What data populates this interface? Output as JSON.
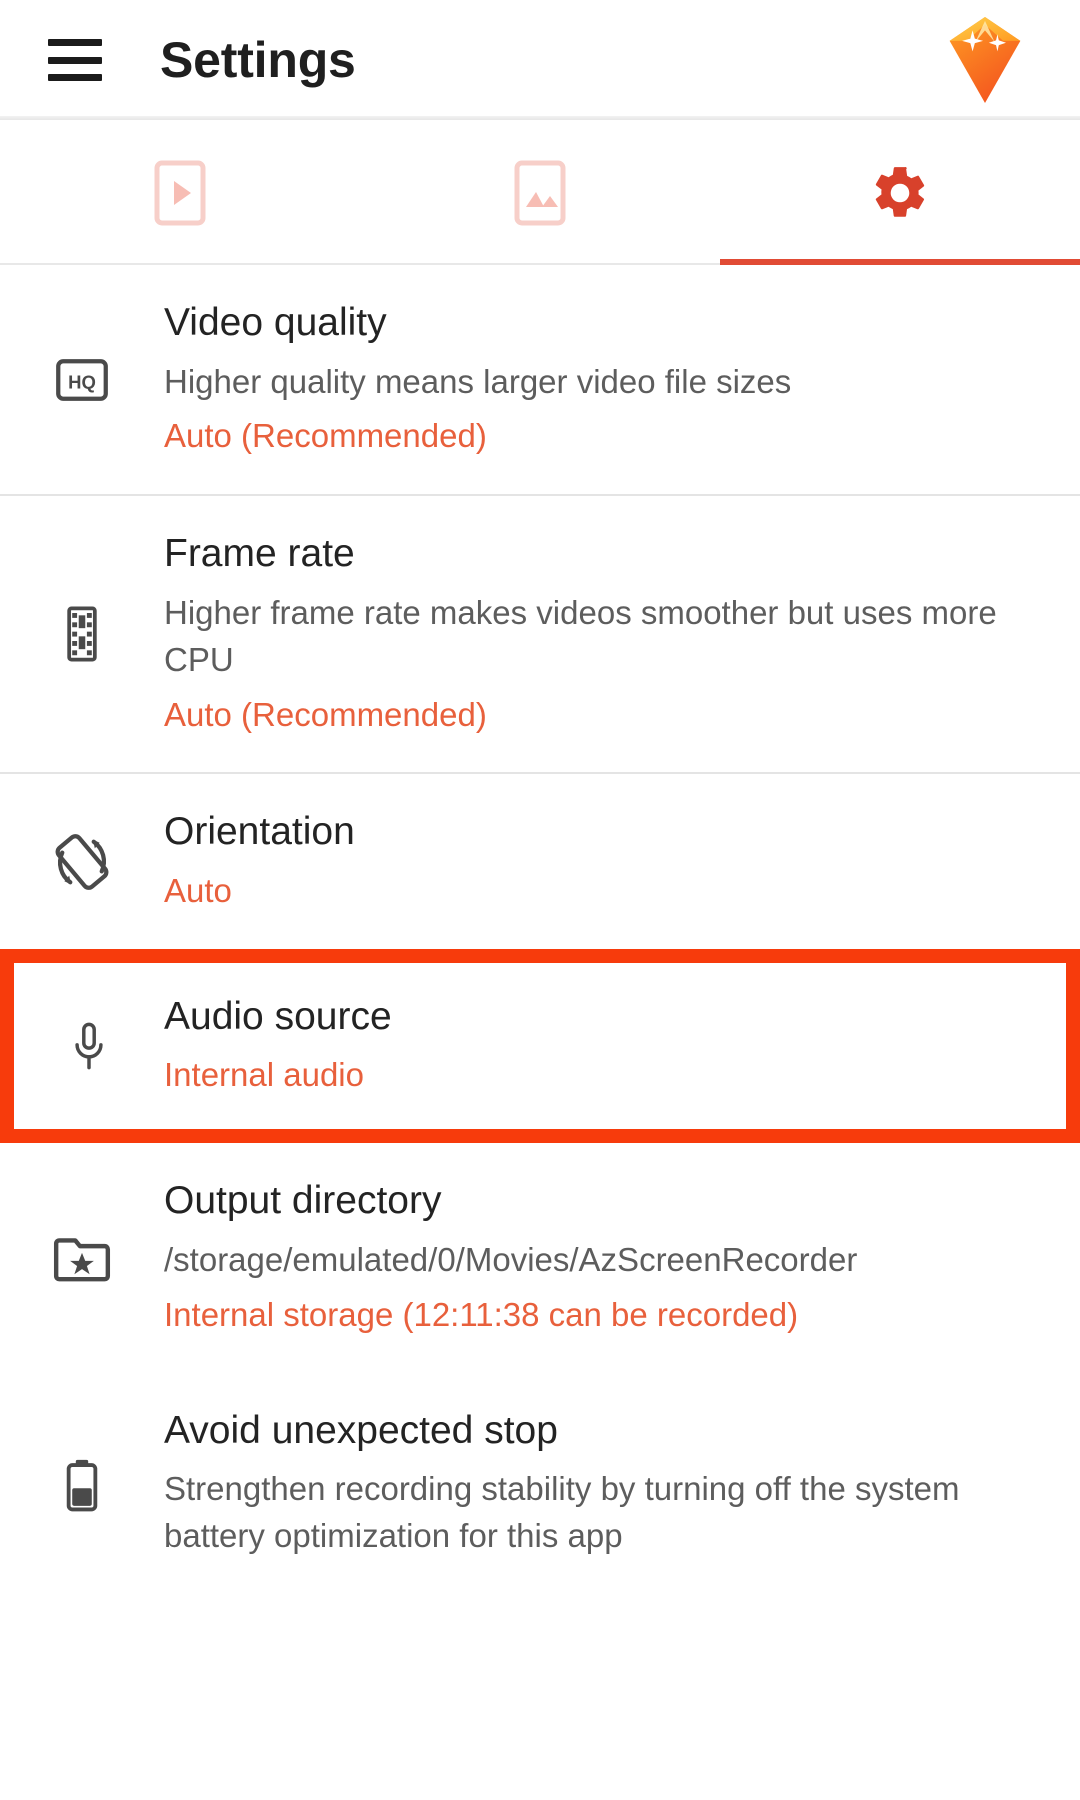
{
  "app": {
    "title": "Settings",
    "menu_icon": "hamburger-menu-icon",
    "logo_icon": "gem-diamond-logo"
  },
  "theme": {
    "accent": "#e8603c",
    "tab_active": "#d8412b",
    "tab_inactive": "#f7cfc9",
    "highlight_box": "#f73b0c",
    "title_text": "#232323",
    "desc_text": "#5d5d5d"
  },
  "tabs": [
    {
      "name": "tab-video",
      "icon": "video-player-icon",
      "active": false
    },
    {
      "name": "tab-images",
      "icon": "image-gallery-icon",
      "active": false
    },
    {
      "name": "tab-settings",
      "icon": "gear-icon",
      "active": true
    }
  ],
  "settings": [
    {
      "key": "video-quality",
      "icon": "hq-badge-icon",
      "title": "Video quality",
      "desc": "Higher quality means larger video file sizes",
      "value": "Auto (Recommended)",
      "highlighted": false
    },
    {
      "key": "frame-rate",
      "icon": "film-strip-icon",
      "title": "Frame rate",
      "desc": "Higher frame rate makes videos smoother but uses more CPU",
      "value": "Auto (Recommended)",
      "highlighted": false
    },
    {
      "key": "orientation",
      "icon": "screen-rotation-icon",
      "title": "Orientation",
      "desc": "",
      "value": "Auto",
      "highlighted": false
    },
    {
      "key": "audio-source",
      "icon": "microphone-icon",
      "title": "Audio source",
      "desc": "",
      "value": "Internal audio",
      "highlighted": true
    },
    {
      "key": "output-directory",
      "icon": "folder-star-icon",
      "title": "Output directory",
      "desc": "/storage/emulated/0/Movies/AzScreenRecorder",
      "value": "Internal storage (12:11:38 can be recorded)",
      "highlighted": false
    },
    {
      "key": "avoid-unexpected-stop",
      "icon": "battery-icon",
      "title": "Avoid unexpected stop",
      "desc": "Strengthen recording stability by turning off the system battery optimization for this app",
      "value": "",
      "highlighted": false
    }
  ]
}
